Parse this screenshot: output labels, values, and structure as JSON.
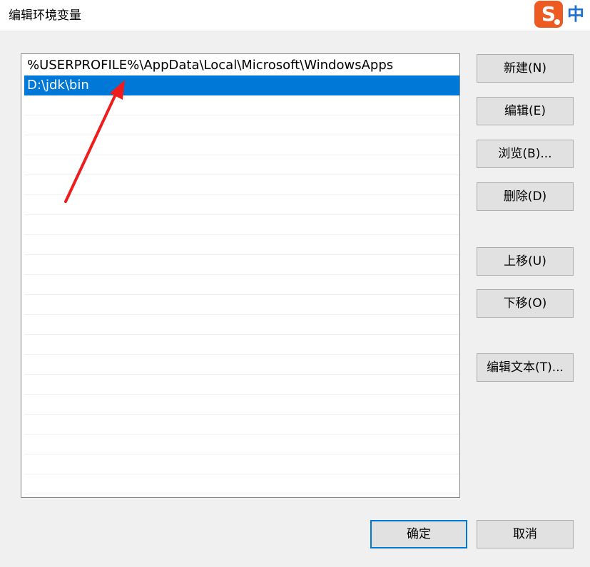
{
  "window": {
    "title": "编辑环境变量"
  },
  "ime": {
    "logo": "S",
    "mode": "中"
  },
  "list": {
    "items": [
      "%USERPROFILE%\\AppData\\Local\\Microsoft\\WindowsApps",
      "D:\\jdk\\bin",
      "",
      "",
      "",
      "",
      "",
      "",
      "",
      "",
      "",
      "",
      "",
      "",
      "",
      "",
      "",
      "",
      "",
      "",
      "",
      ""
    ],
    "selected_index": 1
  },
  "buttons": {
    "new": "新建(N)",
    "edit": "编辑(E)",
    "browse": "浏览(B)...",
    "delete": "删除(D)",
    "move_up": "上移(U)",
    "move_down": "下移(O)",
    "edit_text": "编辑文本(T)...",
    "ok": "确定",
    "cancel": "取消"
  },
  "colors": {
    "selection": "#0078d7",
    "annotation_arrow": "#ee1c1c",
    "ime_brand": "#ee5b22"
  }
}
